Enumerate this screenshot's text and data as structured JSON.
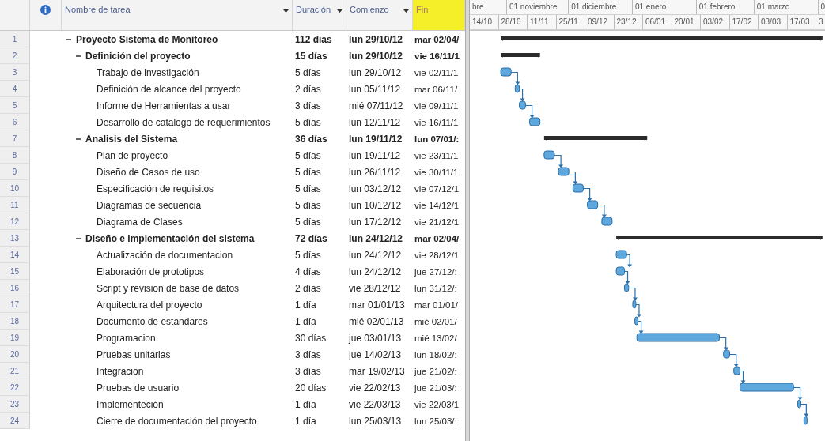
{
  "columns": [
    {
      "kind": "info",
      "selected": false
    },
    {
      "kind": "name",
      "label": "Nombre de tarea",
      "selected": false
    },
    {
      "kind": "duration",
      "label": "Duración",
      "selected": false
    },
    {
      "kind": "start",
      "label": "Comienzo",
      "selected": false
    },
    {
      "kind": "end",
      "label": "Fin",
      "selected": true
    }
  ],
  "timescale": {
    "months": [
      "bre",
      "01 noviembre",
      "01 diciembre",
      "01 enero",
      "01 febrero",
      "01 marzo",
      "0"
    ],
    "weeks": [
      "14/10",
      "28/10",
      "11/11",
      "25/11",
      "09/12",
      "23/12",
      "06/01",
      "20/01",
      "03/02",
      "17/02",
      "03/03",
      "17/03",
      "3"
    ]
  },
  "tasks": [
    {
      "row_number": "1",
      "name": "Proyecto Sistema de Monitoreo",
      "duration": "112 días",
      "start": "lun 29/10/12",
      "end": "mar 02/04/",
      "expanded": true,
      "children": [
        {
          "row_number": "2",
          "name": "Definición del proyecto",
          "duration": "15 días",
          "start": "lun 29/10/12",
          "end": "vie 16/11/1",
          "expanded": true,
          "children": [
            {
              "row_number": "3",
              "name": "Trabajo de investigación",
              "duration": "5 días",
              "start": "lun 29/10/12",
              "end": "vie 02/11/1"
            },
            {
              "row_number": "4",
              "name": "Definición de alcance del proyecto",
              "duration": "2 días",
              "start": "lun 05/11/12",
              "end": "mar 06/11/"
            },
            {
              "row_number": "5",
              "name": "Informe de Herramientas a usar",
              "duration": "3 días",
              "start": "mié 07/11/12",
              "end": "vie 09/11/1"
            },
            {
              "row_number": "6",
              "name": "Desarrollo de catalogo de requerimientos",
              "duration": "5 días",
              "start": "lun 12/11/12",
              "end": "vie 16/11/1"
            }
          ]
        },
        {
          "row_number": "7",
          "name": "Analisis del Sistema",
          "duration": "36 días",
          "start": "lun 19/11/12",
          "end": "lun 07/01/:",
          "expanded": true,
          "children": [
            {
              "row_number": "8",
              "name": "Plan de proyecto",
              "duration": "5 días",
              "start": "lun 19/11/12",
              "end": "vie 23/11/1"
            },
            {
              "row_number": "9",
              "name": "Diseño de Casos de uso",
              "duration": "5 días",
              "start": "lun 26/11/12",
              "end": "vie 30/11/1"
            },
            {
              "row_number": "10",
              "name": "Especificación de requisitos",
              "duration": "5 días",
              "start": "lun 03/12/12",
              "end": "vie 07/12/1"
            },
            {
              "row_number": "11",
              "name": "Diagramas de secuencia",
              "duration": "5 días",
              "start": "lun 10/12/12",
              "end": "vie 14/12/1"
            },
            {
              "row_number": "12",
              "name": "Diagrama de Clases",
              "duration": "5 días",
              "start": "lun 17/12/12",
              "end": "vie 21/12/1"
            }
          ]
        },
        {
          "row_number": "13",
          "name": "Diseño e implementación del sistema",
          "duration": "72 días",
          "start": "lun 24/12/12",
          "end": "mar 02/04/",
          "expanded": true,
          "children": [
            {
              "row_number": "14",
              "name": "Actualización de documentacion",
              "duration": "5 días",
              "start": "lun 24/12/12",
              "end": "vie 28/12/1"
            },
            {
              "row_number": "15",
              "name": "Elaboración de prototipos",
              "duration": "4 días",
              "start": "lun 24/12/12",
              "end": "jue 27/12/:"
            },
            {
              "row_number": "16",
              "name": "Script y revision de base de datos",
              "duration": "2 días",
              "start": "vie 28/12/12",
              "end": "lun 31/12/:"
            },
            {
              "row_number": "17",
              "name": "Arquitectura del proyecto",
              "duration": "1 día",
              "start": "mar 01/01/13",
              "end": "mar 01/01/"
            },
            {
              "row_number": "18",
              "name": "Documento de estandares",
              "duration": "1 día",
              "start": "mié 02/01/13",
              "end": "mié 02/01/"
            },
            {
              "row_number": "19",
              "name": "Programacion",
              "duration": "30 días",
              "start": "jue 03/01/13",
              "end": "mié 13/02/"
            },
            {
              "row_number": "20",
              "name": "Pruebas unitarias",
              "duration": "3 días",
              "start": "jue 14/02/13",
              "end": "lun 18/02/:"
            },
            {
              "row_number": "21",
              "name": "Integracion",
              "duration": "3 días",
              "start": "mar 19/02/13",
              "end": "jue 21/02/:"
            },
            {
              "row_number": "22",
              "name": "Pruebas de usuario",
              "duration": "20 días",
              "start": "vie 22/02/13",
              "end": "jue 21/03/:"
            },
            {
              "row_number": "23",
              "name": "Implementeción",
              "duration": "1 día",
              "start": "vie 22/03/13",
              "end": "vie 22/03/1"
            },
            {
              "row_number": "24",
              "name": "Cierre de documentación del proyecto",
              "duration": "1 día",
              "start": "lun 25/03/13",
              "end": "lun 25/03/:"
            }
          ]
        }
      ]
    }
  ]
}
